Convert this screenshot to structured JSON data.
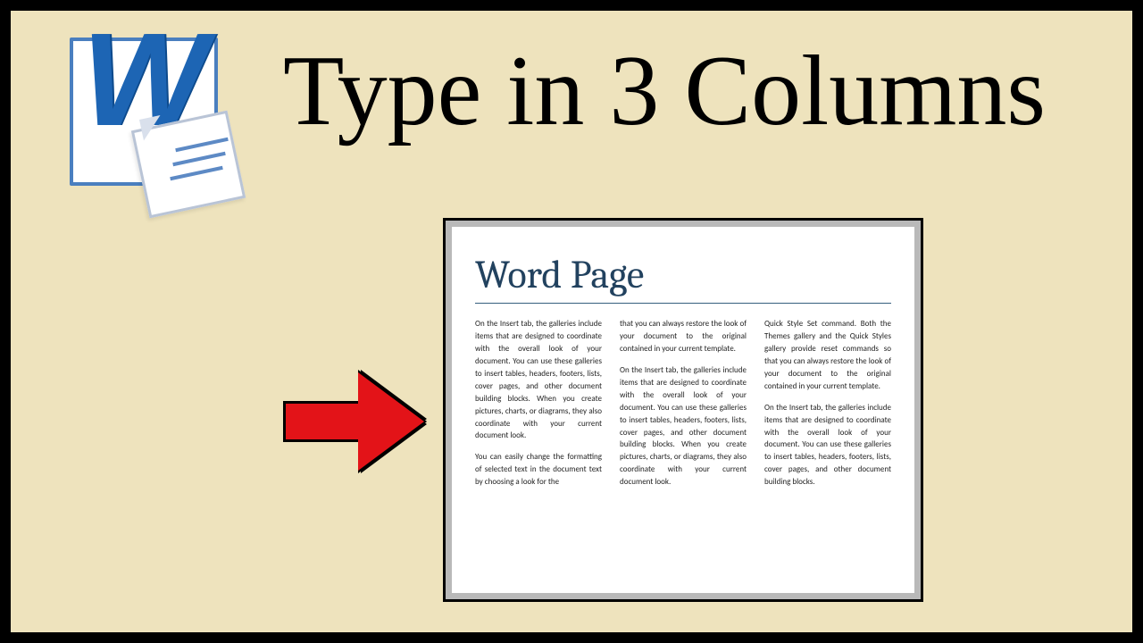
{
  "title": "Type in 3 Columns",
  "icon_letter": "W",
  "icon_name": "word-icon",
  "document": {
    "heading": "Word Page",
    "columns": [
      {
        "paragraphs": [
          "On the Insert tab, the galleries include items that are designed to coordinate with the overall look of your document. You can use these galleries to insert tables, headers, footers, lists, cover pages, and other document building blocks. When you create pictures, charts, or diagrams, they also coordinate with your current document look.",
          "You can easily change the formatting of selected text in the document text by choosing a look for the"
        ]
      },
      {
        "paragraphs": [
          "that you can always restore the look of your document to the original contained in your current template.",
          "On the Insert tab, the galleries include items that are designed to coordinate with the overall look of your document. You can use these galleries to insert tables, headers, footers, lists, cover pages, and other document building blocks. When you create pictures, charts, or diagrams, they also coordinate with your current document look."
        ]
      },
      {
        "paragraphs": [
          "Quick Style Set command. Both the Themes gallery and the Quick Styles gallery provide reset commands so that you can always restore the look of your document to the original contained in your current template.",
          "On the Insert tab, the galleries include items that are designed to coordinate with the overall look of your document. You can use these galleries to insert tables, headers, footers, lists, cover pages, and other document building blocks."
        ]
      }
    ]
  }
}
